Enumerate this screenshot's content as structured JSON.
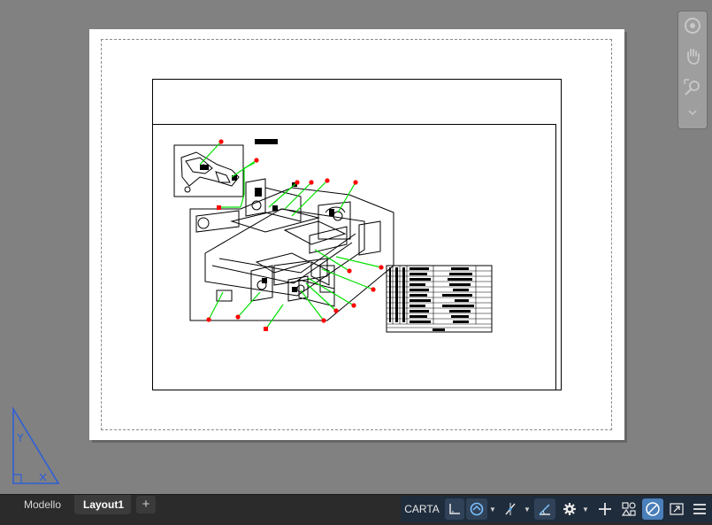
{
  "layout_tabs": [
    {
      "label": "Modello",
      "active": false
    },
    {
      "label": "Layout1",
      "active": true
    }
  ],
  "add_tab_symbol": "+",
  "status_bar": {
    "paper_space_label": "CARTA",
    "buttons": [
      "grid-icon",
      "snap-icon",
      "ortho-icon",
      "polar-icon",
      "isodraft-icon",
      "osnap-tracking-icon",
      "gear-icon",
      "plus-icon",
      "annotation-scale-icon",
      "isolate-objects-icon",
      "fullscreen-icon",
      "customize-menu-icon"
    ]
  },
  "colors": {
    "canvas": "#818181",
    "paper": "#ffffff",
    "leader": "#00e000",
    "balloon": "#ff0000",
    "statusbar": "#1f2c3c"
  },
  "navigation_bar": [
    "steeringwheel-icon",
    "pan-icon",
    "zoom-extents-icon",
    "menu-icon"
  ]
}
